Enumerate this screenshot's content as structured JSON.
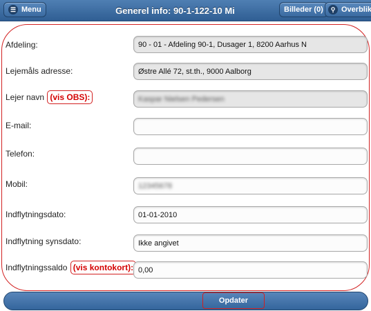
{
  "header": {
    "menu_label": "Menu",
    "title": "Generel info: 90-1-122-10 Mi",
    "images_label": "Billeder (0)",
    "overview_label": "Overblik"
  },
  "form": {
    "afdeling": {
      "label": "Afdeling:",
      "value": "90 - 01 - Afdeling 90-1, Dusager 1, 8200 Aarhus N"
    },
    "adresse": {
      "label": "Lejemåls adresse:",
      "value": "Østre Allé 72, st.th., 9000 Aalborg"
    },
    "lejer": {
      "label": "Lejer navn",
      "note": "(vis OBS)",
      "suffix": ":",
      "value": "Kaspar Nielsen Pedersen"
    },
    "email": {
      "label": "E-mail:",
      "value": ""
    },
    "telefon": {
      "label": "Telefon:",
      "value": ""
    },
    "mobil": {
      "label": "Mobil:",
      "value": "12345678"
    },
    "indflytningsdato": {
      "label": "Indflytningsdato:",
      "value": "01-01-2010"
    },
    "synsdato": {
      "label": "Indflytning synsdato:",
      "value": "Ikke angivet"
    },
    "saldo": {
      "label": "Indflytningssaldo",
      "note": "(vis kontokort)",
      "suffix": ":",
      "value": "0,00"
    }
  },
  "footer": {
    "update_label": "Opdater"
  },
  "colors": {
    "header_bg": "#3a6aa0",
    "annotation_red": "#d21f1f"
  }
}
